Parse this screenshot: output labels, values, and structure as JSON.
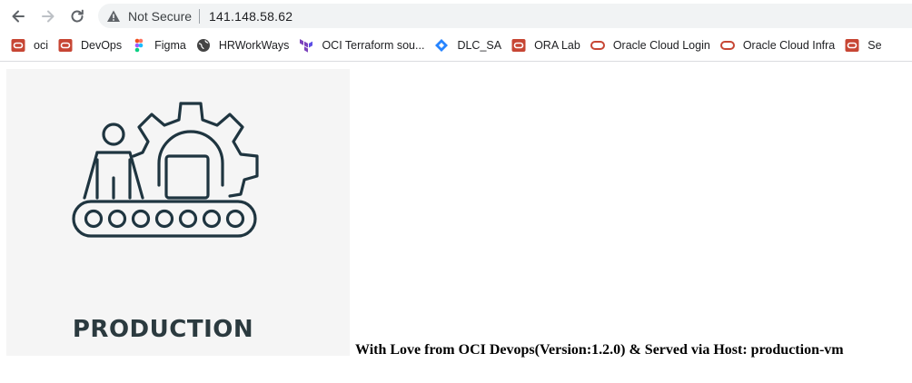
{
  "browser": {
    "security_label": "Not Secure",
    "url": "141.148.58.62",
    "bookmarks": [
      {
        "label": "oci",
        "icon": "oracle-icon"
      },
      {
        "label": "DevOps",
        "icon": "oracle-icon"
      },
      {
        "label": "Figma",
        "icon": "figma-icon"
      },
      {
        "label": "HRWorkWays",
        "icon": "globe-icon"
      },
      {
        "label": "OCI Terraform sou...",
        "icon": "terraform-icon"
      },
      {
        "label": "DLC_SA",
        "icon": "diamond-icon"
      },
      {
        "label": "ORA Lab",
        "icon": "oracle-icon"
      },
      {
        "label": "Oracle Cloud Login",
        "icon": "oracle-cloud-icon"
      },
      {
        "label": "Oracle Cloud Infra",
        "icon": "oracle-cloud-icon"
      },
      {
        "label": "Se",
        "icon": "oracle-icon"
      }
    ]
  },
  "page": {
    "image_caption": "PRODUCTION",
    "message": "With Love from OCI Devops(Version:1.2.0) & Served via Host: production-vm"
  },
  "colors": {
    "oracle_red": "#c74634",
    "illustration_stroke": "#1f3540",
    "chrome_bg": "#f1f3f4"
  }
}
